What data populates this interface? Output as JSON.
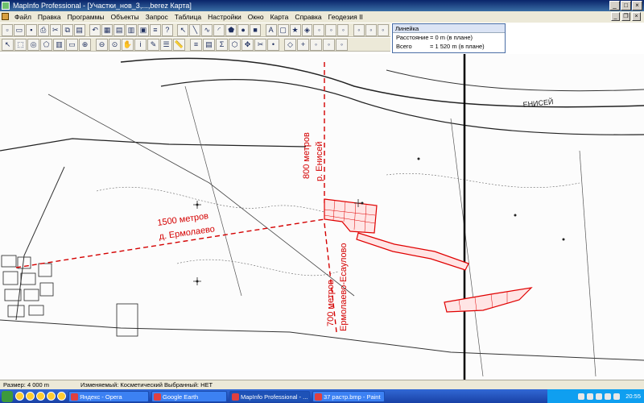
{
  "window": {
    "title": "MapInfo Professional - [Участки_нов_3,...,berez Карта]"
  },
  "menu": [
    "Файл",
    "Правка",
    "Программы",
    "Объекты",
    "Запрос",
    "Таблица",
    "Настройки",
    "Окно",
    "Карта",
    "Справка",
    "Геодезия II"
  ],
  "toolbar1": [
    "new-icon",
    "open-icon",
    "save-icon",
    "print-icon",
    "cut-icon",
    "copy-icon",
    "paste-icon",
    "undo-icon",
    "map-window-icon",
    "browser-icon",
    "graph-icon",
    "layout-icon",
    "legend-icon",
    "help-icon",
    "pointer-icon",
    "line-icon",
    "polyline-icon",
    "arc-icon",
    "polygon-icon",
    "ellipse-icon",
    "rectangle-icon",
    "text-icon",
    "frame-icon",
    "symbol-icon",
    "style-icon",
    "tool-icon",
    "tool2-icon",
    "tool3-icon",
    "tool4-icon",
    "tool5-icon",
    "tool6-icon"
  ],
  "toolbar2": [
    "select-icon",
    "marquee-icon",
    "radius-icon",
    "polygon-select-icon",
    "boundary-icon",
    "unselect-icon",
    "zoom-in-icon",
    "zoom-out-icon",
    "change-view-icon",
    "grabber-icon",
    "info-icon",
    "label-icon",
    "layer-control-icon",
    "ruler-icon",
    "legend-icon",
    "statistics-icon",
    "sum-icon",
    "region-icon",
    "drag-icon",
    "clip-icon",
    "node-icon",
    "reshape-icon",
    "add-node-icon",
    "geo-icon",
    "geo2-icon",
    "geo3-icon"
  ],
  "ruler": {
    "title": "Линейка",
    "rows": [
      {
        "label": "Расстояние",
        "value": "= 0 m (в плане)"
      },
      {
        "label": "Всего",
        "value": "= 1 520 m (в плане)"
      }
    ]
  },
  "map": {
    "river_label": "ЕНИСЕЙ",
    "annotations": [
      {
        "text": "800 метров"
      },
      {
        "text": "р. Енисей"
      },
      {
        "text": "1500 метров"
      },
      {
        "text": "д. Ермолаево"
      },
      {
        "text": "700 метров"
      },
      {
        "text": "Ермолаево-Есаулово"
      }
    ],
    "colors": {
      "annotation": "#d40000",
      "map_lines": "#222222",
      "parcels": "#e00000"
    }
  },
  "status": {
    "size": "Размер: 4 000 m",
    "editable": "Изменяемый: Косметический  Выбранный: НЕТ"
  },
  "taskbar": {
    "tasks": [
      {
        "label": "Яндекс - Opera",
        "active": false
      },
      {
        "label": "Google Earth",
        "active": false
      },
      {
        "label": "MapInfo Professional - ...",
        "active": true
      },
      {
        "label": "37 растр.bmp - Paint",
        "active": false
      }
    ],
    "clock": "20:55"
  }
}
